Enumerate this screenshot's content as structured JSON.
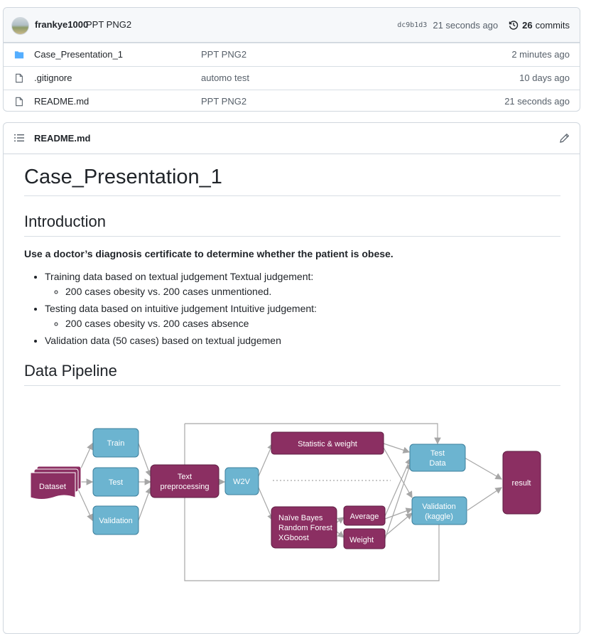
{
  "commit": {
    "author": "frankye1000",
    "message": "PPT PNG2",
    "sha": "dc9b1d3",
    "age": "21 seconds ago",
    "count": "26",
    "count_label": "commits"
  },
  "files": [
    {
      "name": "Case_Presentation_1",
      "type": "folder",
      "message": "PPT PNG2",
      "age": "2 minutes ago"
    },
    {
      "name": ".gitignore",
      "type": "file",
      "message": "automo test",
      "age": "10 days ago"
    },
    {
      "name": "README.md",
      "type": "file",
      "message": "PPT PNG2",
      "age": "21 seconds ago"
    }
  ],
  "readme": {
    "header_title": "README.md",
    "h1": "Case_Presentation_1",
    "intro_heading": "Introduction",
    "intro_text": "Use a doctor’s diagnosis certificate to determine whether the patient is obese.",
    "bullets": [
      {
        "text": "Training data based on textual judgement Textual judgement:",
        "sub": "200 cases obesity vs. 200 cases unmentioned."
      },
      {
        "text": "Testing data based on intuitive judgement Intuitive judgement:",
        "sub": "200 cases obesity vs. 200 cases absence"
      },
      {
        "text": "Validation data (50 cases) based on textual judgemen",
        "sub": ""
      }
    ],
    "pipeline_heading": "Data Pipeline"
  },
  "diagram": {
    "dataset": "Dataset",
    "train": "Train",
    "test": "Test",
    "validation": "Validation",
    "text_pre_1": "Text",
    "text_pre_2": "preprocessing",
    "w2v": "W2V",
    "stat": "Statistic & weight",
    "models_1": "Naïve Bayes",
    "models_2": "Random Forest",
    "models_3": "XGboost",
    "average": "Average",
    "weight": "Weight",
    "test_data_1": "Test",
    "test_data_2": "Data",
    "val_kaggle_1": "Validation",
    "val_kaggle_2": "(kaggle)",
    "result": "result",
    "colors": {
      "maroon": "#8b2f62",
      "blue": "#6cb4d0",
      "arrow": "#a6a6a6"
    }
  }
}
